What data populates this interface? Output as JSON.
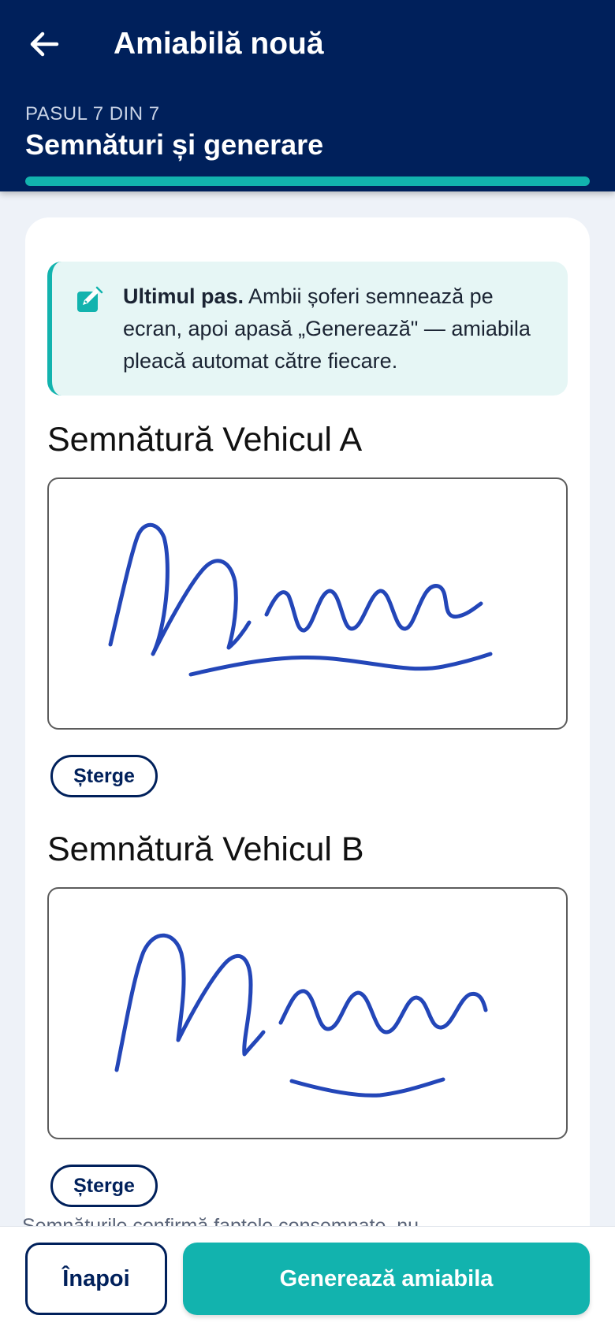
{
  "header": {
    "title": "Amiabilă nouă",
    "back_icon": "arrow-left-icon",
    "step_label": "PASUL 7 DIN 7",
    "step_title": "Semnături și generare",
    "progress": 1.0
  },
  "info": {
    "icon": "edit-icon",
    "bold": "Ultimul pas.",
    "text": " Ambii șoferi semnează pe ecran, apoi apasă „Generează\" — amiabila pleacă automat către fiecare."
  },
  "signatures": [
    {
      "title": "Semnătură Vehicul A",
      "clear_label": "Șterge"
    },
    {
      "title": "Semnătură Vehicul B",
      "clear_label": "Șterge"
    }
  ],
  "disclaimer": "Semnăturile confirmă faptele consemnate, nu",
  "footer": {
    "back_label": "Înapoi",
    "generate_label": "Generează amiabila"
  },
  "colors": {
    "header": "#00205b",
    "accent": "#12b3ae",
    "signature_ink": "#2346b8"
  }
}
